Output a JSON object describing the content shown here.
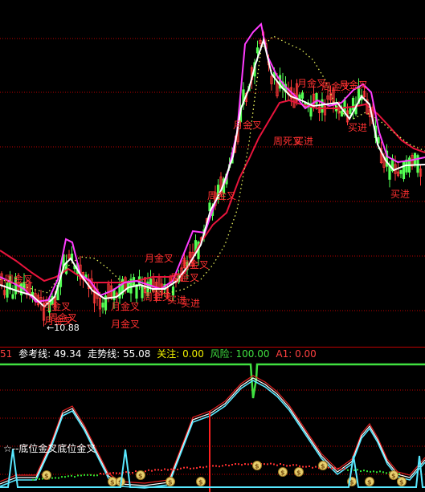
{
  "main_chart": {
    "low_label": "10.88",
    "annotations": [
      {
        "text": "月金叉",
        "color": "#ff3030"
      },
      {
        "text": "月金叉",
        "color": "#ff3030"
      },
      {
        "text": "周金叉",
        "color": "#ff3030"
      },
      {
        "text": "月金叉",
        "color": "#ff3030"
      },
      {
        "text": "周死叉",
        "color": "#ff3030"
      },
      {
        "text": "买进",
        "color": "#ff3030"
      },
      {
        "text": "月金叉",
        "color": "#ff3030"
      },
      {
        "text": "周金叉",
        "color": "#ff3030"
      },
      {
        "text": "周金叉",
        "color": "#ff3030"
      },
      {
        "text": "买进",
        "color": "#ff3030"
      },
      {
        "text": "周金叉",
        "color": "#ff3030"
      },
      {
        "text": "月金叉",
        "color": "#ff3030"
      },
      {
        "text": "周金叉",
        "color": "#ff3030"
      },
      {
        "text": "买进",
        "color": "#ff3030"
      },
      {
        "text": "月金叉",
        "color": "#ff3030"
      },
      {
        "text": "周金叉",
        "color": "#ff3030"
      },
      {
        "text": "买进",
        "color": "#ff3030"
      },
      {
        "text": "月金叉",
        "color": "#ff3030"
      },
      {
        "text": "月金叉",
        "color": "#ff3030"
      },
      {
        "text": "周金叉",
        "color": "#ff3030"
      },
      {
        "text": "买进",
        "color": "#ff3030"
      }
    ]
  },
  "info_bar": {
    "prefix": "51",
    "ref_label": "参考线:",
    "ref_value": "49.34",
    "trend_label": "走势线:",
    "trend_value": "55.08",
    "focus_label": "关注:",
    "focus_value": "0.00",
    "risk_label": "风险:",
    "risk_value": "100.00",
    "a1_label": "A1:",
    "a1_value": "0.00"
  },
  "indicator_panel": {
    "legend_text": "☆--底位金叉底位金叉",
    "money_icon_count": 14
  },
  "colors": {
    "up": "#ff3a3a",
    "down": "#54ff54",
    "price_white": "#ffffff",
    "price_magenta": "#ff3cff",
    "ma_red": "#e8143c",
    "dotted": "#e8f05a",
    "grid": "#c00000",
    "cyan": "#58e8ff",
    "green_line": "#40e040"
  }
}
